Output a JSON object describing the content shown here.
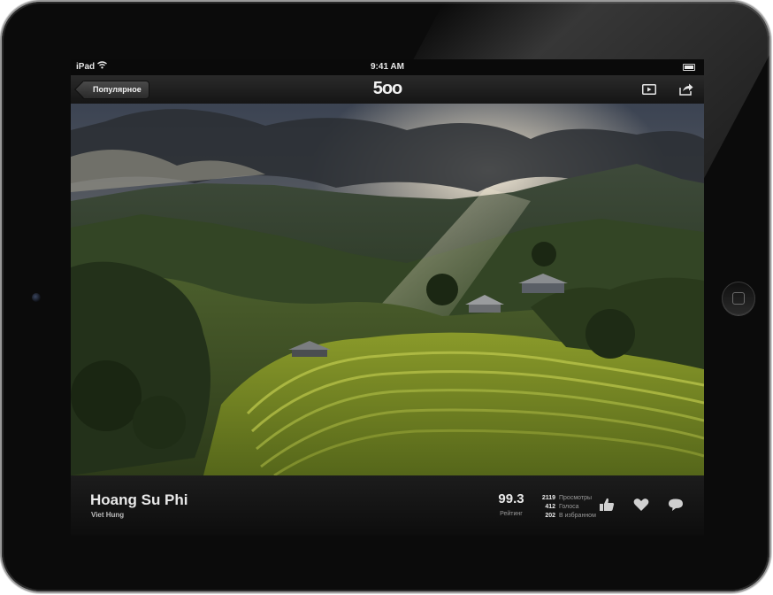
{
  "status_bar": {
    "carrier": "iPad",
    "time": "9:41 AM"
  },
  "nav_bar": {
    "back_label": "Популярное",
    "logo": "5oo"
  },
  "photo": {
    "title": "Hoang Su Phi",
    "author": "Viet Hung",
    "rating_value": "99.3",
    "rating_label": "Рейтинг",
    "stats": [
      {
        "value": "2119",
        "label": "Просмотры"
      },
      {
        "value": "412",
        "label": "Голоса"
      },
      {
        "value": "202",
        "label": "В избранном"
      }
    ]
  },
  "icons": {
    "nav": [
      "play-icon",
      "share-icon"
    ],
    "actions": [
      "like-icon",
      "heart-icon",
      "comment-icon"
    ]
  }
}
